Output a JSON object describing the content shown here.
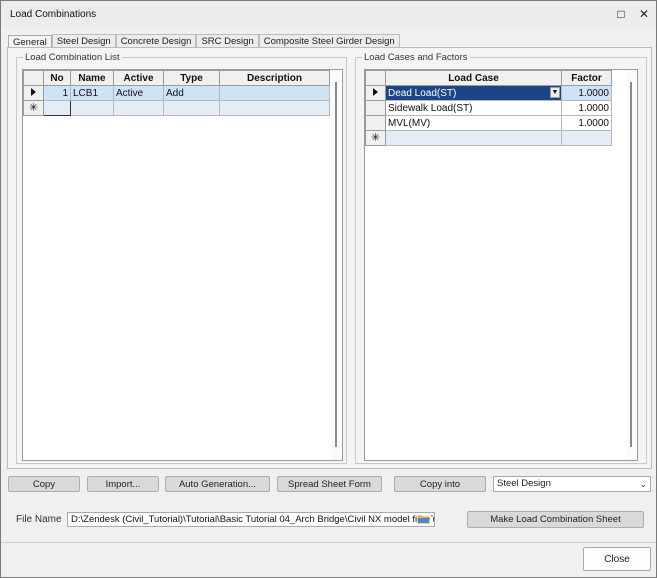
{
  "window": {
    "title": "Load Combinations"
  },
  "tabs": [
    "General",
    "Steel Design",
    "Concrete Design",
    "SRC Design",
    "Composite Steel Girder Design"
  ],
  "left_panel": {
    "label": "Load Combination List",
    "columns": [
      "No",
      "Name",
      "Active",
      "Type",
      "Description"
    ],
    "rows": [
      {
        "no": "1",
        "name": "LCB1",
        "active": "Active",
        "type": "Add",
        "description": ""
      }
    ]
  },
  "right_panel": {
    "label": "Load Cases and Factors",
    "columns": [
      "Load Case",
      "Factor"
    ],
    "rows": [
      {
        "load_case": "Dead Load(ST)",
        "factor": "1.0000"
      },
      {
        "load_case": "Sidewalk Load(ST)",
        "factor": "1.0000"
      },
      {
        "load_case": "MVL(MV)",
        "factor": "1.0000"
      }
    ]
  },
  "buttons": {
    "copy": "Copy",
    "import": "Import...",
    "auto_generation": "Auto Generation...",
    "spread_sheet_form": "Spread Sheet Form",
    "copy_into": "Copy into",
    "make_sheet": "Make Load Combination Sheet",
    "close": "Close"
  },
  "copy_into_select": {
    "selected": "Steel Design"
  },
  "file": {
    "label": "File Name",
    "path": "D:\\Zendesk (Civil_Tutorial)\\Tutorial\\Basic Tutorial 04_Arch Bridge\\Civil NX model file\\Tu"
  },
  "icons": {
    "minimize": "minimize-icon",
    "close": "close-icon",
    "row_pointer": "row-pointer-icon",
    "new_row": "new-row-icon",
    "folder": "folder-icon",
    "dropdown": "chevron-down-icon"
  },
  "colors": {
    "selected_row": "#cfe3f7",
    "highlight_cell": "#1c4587",
    "new_row": "#e4edf7"
  }
}
